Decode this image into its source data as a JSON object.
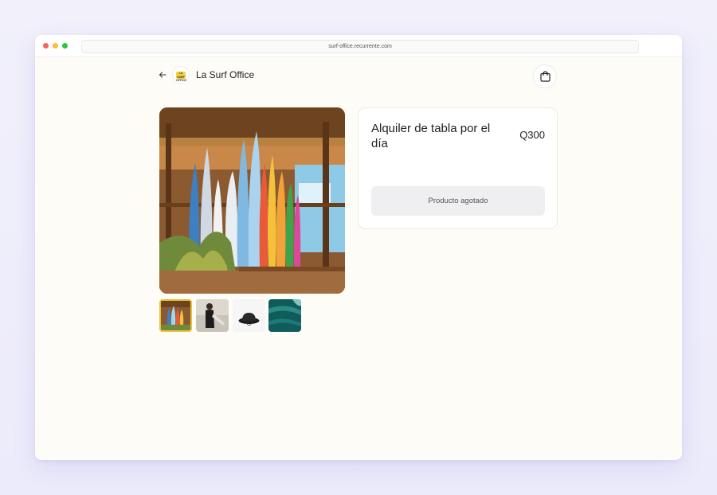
{
  "browser": {
    "url": "surf-office.recurrente.com"
  },
  "header": {
    "back_icon": "arrow-left-icon",
    "logo_text": "LA SURF OFFICE",
    "shop_name": "La Surf Office",
    "cart_icon": "shopping-bag-icon"
  },
  "product": {
    "title": "Alquiler de tabla por el día",
    "price": "Q300",
    "status_button": "Producto agotado",
    "thumbnails": [
      "surfboards-rack",
      "surfer-wetsuit",
      "bucket-hat",
      "ocean-wave"
    ]
  },
  "colors": {
    "accent": "#e8c23a",
    "page_bg": "#fdfcf6",
    "button_bg": "#efeff1"
  }
}
